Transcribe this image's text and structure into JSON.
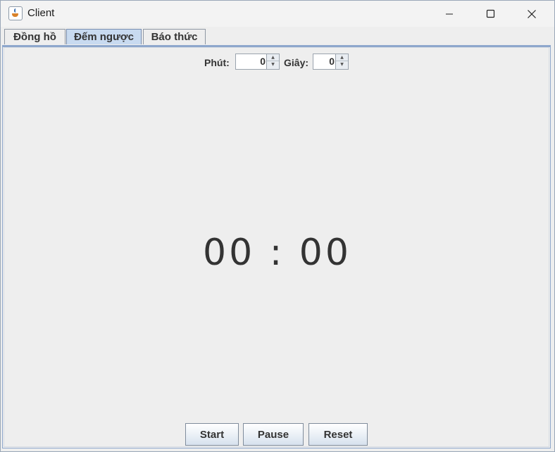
{
  "window": {
    "title": "Client",
    "controls": {
      "minimize_icon": "minimize-icon",
      "maximize_icon": "maximize-icon",
      "close_icon": "close-icon"
    }
  },
  "tabs": [
    {
      "label": "Đồng hồ",
      "selected": false
    },
    {
      "label": "Đếm ngược",
      "selected": true
    },
    {
      "label": "Báo thức",
      "selected": false
    }
  ],
  "countdown": {
    "minutes_label": "Phút:",
    "minutes_value": "0",
    "seconds_label": "Giây:",
    "seconds_value": "0",
    "display": "00 : 00"
  },
  "buttons": {
    "start": "Start",
    "pause": "Pause",
    "reset": "Reset"
  },
  "colors": {
    "selected_tab": "#c8daf0",
    "panel_border": "#8ea7cc",
    "text": "#333333"
  }
}
